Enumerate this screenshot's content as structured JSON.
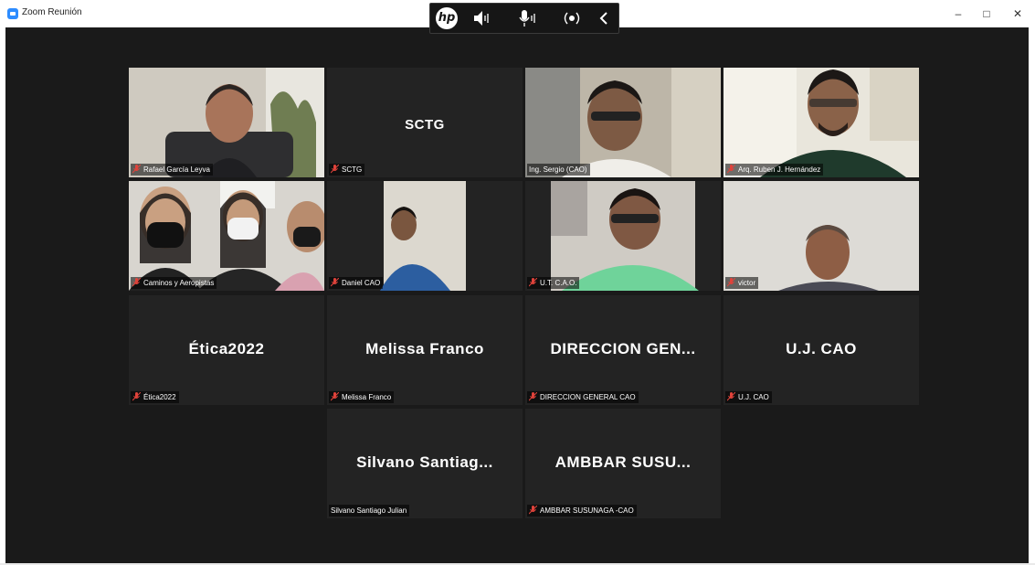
{
  "window": {
    "title": "Zoom Reunión",
    "minimize": "–",
    "maximize": "□",
    "close": "✕",
    "hp_logo": "hp"
  },
  "participants": [
    {
      "label": "Rafael García Leyva",
      "muted": true
    },
    {
      "label": "SCTG",
      "display": "SCTG",
      "muted": true
    },
    {
      "label": "Ing. Sergio (CAO)",
      "muted": false,
      "active_speaker": true
    },
    {
      "label": "Arq. Ruben J. Hernández",
      "muted": true
    },
    {
      "label": "Caminos y Aeropistas",
      "muted": true
    },
    {
      "label": "Daniel CAO",
      "muted": true
    },
    {
      "label": "U.T. C.A.O.",
      "muted": true
    },
    {
      "label": "victor",
      "muted": true
    },
    {
      "label": "Ética2022",
      "display": "Ética2022",
      "muted": true
    },
    {
      "label": "Melissa Franco",
      "display": "Melissa Franco",
      "muted": true
    },
    {
      "label": "DIRECCION GENERAL CAO",
      "display": "DIRECCION  GEN...",
      "muted": true
    },
    {
      "label": "U.J. CAO",
      "display": "U.J. CAO",
      "muted": true
    },
    {
      "label": "Silvano Santiago Julian",
      "display": "Silvano  Santiag...",
      "muted": false
    },
    {
      "label": "AMBBAR SUSUNAGA -CAO",
      "display": "AMBBAR  SUSU...",
      "muted": true
    }
  ],
  "colors": {
    "active_speaker": "#b8e05a",
    "mute_icon": "#e0433b",
    "stage": "#1a1a1a",
    "tile": "#232323"
  }
}
